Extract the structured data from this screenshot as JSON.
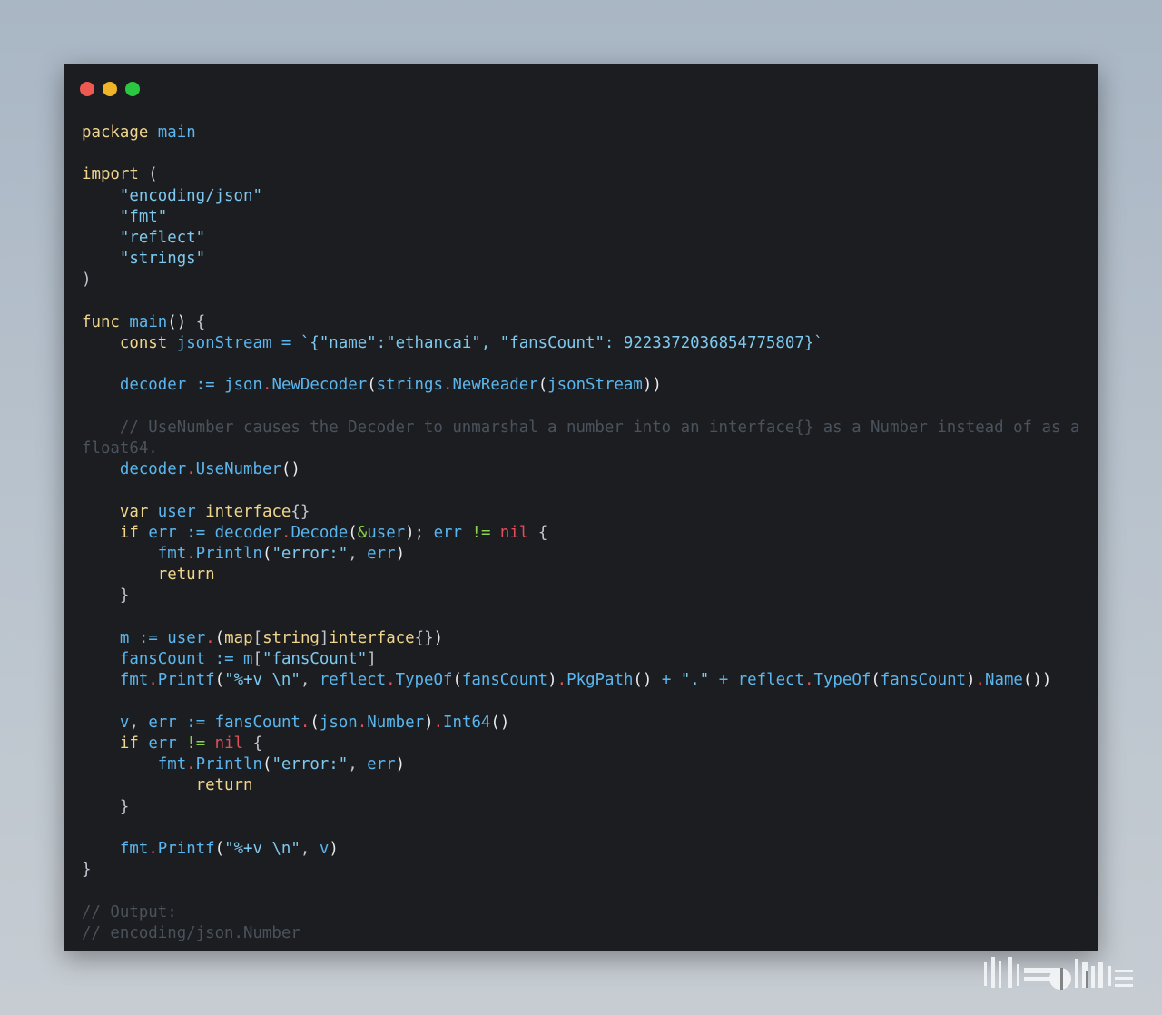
{
  "window": {
    "traffic_lights": [
      {
        "name": "close",
        "color": "#ee5a52"
      },
      {
        "name": "minimize",
        "color": "#f0b428"
      },
      {
        "name": "maximize",
        "color": "#2ac840"
      }
    ]
  },
  "code": {
    "language": "go",
    "lines": [
      [
        [
          "kw",
          "package"
        ],
        [
          "plain",
          " "
        ],
        [
          "id",
          "main"
        ]
      ],
      [],
      [
        [
          "kw",
          "import"
        ],
        [
          "plain",
          " ("
        ]
      ],
      [
        [
          "plain",
          "    "
        ],
        [
          "str",
          "\"encoding/json\""
        ]
      ],
      [
        [
          "plain",
          "    "
        ],
        [
          "str",
          "\"fmt\""
        ]
      ],
      [
        [
          "plain",
          "    "
        ],
        [
          "str",
          "\"reflect\""
        ]
      ],
      [
        [
          "plain",
          "    "
        ],
        [
          "str",
          "\"strings\""
        ]
      ],
      [
        [
          "plain",
          ")"
        ]
      ],
      [],
      [
        [
          "kw",
          "func"
        ],
        [
          "plain",
          " "
        ],
        [
          "id",
          "main"
        ],
        [
          "paren",
          "()"
        ],
        [
          "plain",
          " {"
        ]
      ],
      [
        [
          "plain",
          "    "
        ],
        [
          "kw",
          "const"
        ],
        [
          "plain",
          " "
        ],
        [
          "id",
          "jsonStream"
        ],
        [
          "plain",
          " "
        ],
        [
          "op",
          "="
        ],
        [
          "plain",
          " "
        ],
        [
          "str",
          "`{\"name\":\"ethancai\", \"fansCount\": 9223372036854775807}`"
        ]
      ],
      [],
      [
        [
          "plain",
          "    "
        ],
        [
          "id",
          "decoder"
        ],
        [
          "plain",
          " "
        ],
        [
          "op",
          ":="
        ],
        [
          "plain",
          " "
        ],
        [
          "id",
          "json"
        ],
        [
          "dotop",
          "."
        ],
        [
          "id",
          "NewDecoder"
        ],
        [
          "paren",
          "("
        ],
        [
          "id",
          "strings"
        ],
        [
          "dotop",
          "."
        ],
        [
          "id",
          "NewReader"
        ],
        [
          "paren",
          "("
        ],
        [
          "id",
          "jsonStream"
        ],
        [
          "paren",
          "))"
        ]
      ],
      [],
      [
        [
          "plain",
          "    "
        ],
        [
          "cmt",
          "// UseNumber causes the Decoder to unmarshal a number into an interface{} as a Number instead of as a float64."
        ]
      ],
      [
        [
          "plain",
          "    "
        ],
        [
          "id",
          "decoder"
        ],
        [
          "dotop",
          "."
        ],
        [
          "id",
          "UseNumber"
        ],
        [
          "paren",
          "()"
        ]
      ],
      [],
      [
        [
          "plain",
          "    "
        ],
        [
          "kw",
          "var"
        ],
        [
          "plain",
          " "
        ],
        [
          "id",
          "user"
        ],
        [
          "plain",
          " "
        ],
        [
          "kw",
          "interface"
        ],
        [
          "plain",
          "{}"
        ]
      ],
      [
        [
          "plain",
          "    "
        ],
        [
          "kw",
          "if"
        ],
        [
          "plain",
          " "
        ],
        [
          "id",
          "err"
        ],
        [
          "plain",
          " "
        ],
        [
          "op",
          ":="
        ],
        [
          "plain",
          " "
        ],
        [
          "id",
          "decoder"
        ],
        [
          "dotop",
          "."
        ],
        [
          "id",
          "Decode"
        ],
        [
          "paren",
          "("
        ],
        [
          "amp",
          "&"
        ],
        [
          "id",
          "user"
        ],
        [
          "paren",
          ")"
        ],
        [
          "plain",
          "; "
        ],
        [
          "id",
          "err"
        ],
        [
          "plain",
          " "
        ],
        [
          "neq",
          "!="
        ],
        [
          "plain",
          " "
        ],
        [
          "nil",
          "nil"
        ],
        [
          "plain",
          " {"
        ]
      ],
      [
        [
          "plain",
          "        "
        ],
        [
          "id",
          "fmt"
        ],
        [
          "dotop",
          "."
        ],
        [
          "id",
          "Println"
        ],
        [
          "paren",
          "("
        ],
        [
          "str",
          "\"error:\""
        ],
        [
          "plain",
          ", "
        ],
        [
          "id",
          "err"
        ],
        [
          "paren",
          ")"
        ]
      ],
      [
        [
          "plain",
          "        "
        ],
        [
          "kw",
          "return"
        ]
      ],
      [
        [
          "plain",
          "    }"
        ]
      ],
      [],
      [
        [
          "plain",
          "    "
        ],
        [
          "id",
          "m"
        ],
        [
          "plain",
          " "
        ],
        [
          "op",
          ":="
        ],
        [
          "plain",
          " "
        ],
        [
          "id",
          "user"
        ],
        [
          "dotop",
          "."
        ],
        [
          "paren",
          "("
        ],
        [
          "kw",
          "map"
        ],
        [
          "plain",
          "["
        ],
        [
          "kw",
          "string"
        ],
        [
          "plain",
          "]"
        ],
        [
          "kw",
          "interface"
        ],
        [
          "plain",
          "{}"
        ],
        [
          "paren",
          ")"
        ]
      ],
      [
        [
          "plain",
          "    "
        ],
        [
          "id",
          "fansCount"
        ],
        [
          "plain",
          " "
        ],
        [
          "op",
          ":="
        ],
        [
          "plain",
          " "
        ],
        [
          "id",
          "m"
        ],
        [
          "plain",
          "["
        ],
        [
          "str",
          "\"fansCount\""
        ],
        [
          "plain",
          "]"
        ]
      ],
      [
        [
          "plain",
          "    "
        ],
        [
          "id",
          "fmt"
        ],
        [
          "dotop",
          "."
        ],
        [
          "id",
          "Printf"
        ],
        [
          "paren",
          "("
        ],
        [
          "str",
          "\"%+v \\n\""
        ],
        [
          "plain",
          ", "
        ],
        [
          "id",
          "reflect"
        ],
        [
          "dotop",
          "."
        ],
        [
          "id",
          "TypeOf"
        ],
        [
          "paren",
          "("
        ],
        [
          "id",
          "fansCount"
        ],
        [
          "paren",
          ")"
        ],
        [
          "dotop",
          "."
        ],
        [
          "id",
          "PkgPath"
        ],
        [
          "paren",
          "()"
        ],
        [
          "plain",
          " "
        ],
        [
          "op",
          "+"
        ],
        [
          "plain",
          " "
        ],
        [
          "str",
          "\".\""
        ],
        [
          "plain",
          " "
        ],
        [
          "op",
          "+"
        ],
        [
          "plain",
          " "
        ],
        [
          "id",
          "reflect"
        ],
        [
          "dotop",
          "."
        ],
        [
          "id",
          "TypeOf"
        ],
        [
          "paren",
          "("
        ],
        [
          "id",
          "fansCount"
        ],
        [
          "paren",
          ")"
        ],
        [
          "dotop",
          "."
        ],
        [
          "id",
          "Name"
        ],
        [
          "paren",
          "())"
        ]
      ],
      [],
      [
        [
          "plain",
          "    "
        ],
        [
          "id",
          "v"
        ],
        [
          "plain",
          ", "
        ],
        [
          "id",
          "err"
        ],
        [
          "plain",
          " "
        ],
        [
          "op",
          ":="
        ],
        [
          "plain",
          " "
        ],
        [
          "id",
          "fansCount"
        ],
        [
          "dotop",
          "."
        ],
        [
          "paren",
          "("
        ],
        [
          "id",
          "json"
        ],
        [
          "dotop",
          "."
        ],
        [
          "id",
          "Number"
        ],
        [
          "paren",
          ")"
        ],
        [
          "dotop",
          "."
        ],
        [
          "id",
          "Int64"
        ],
        [
          "paren",
          "()"
        ]
      ],
      [
        [
          "plain",
          "    "
        ],
        [
          "kw",
          "if"
        ],
        [
          "plain",
          " "
        ],
        [
          "id",
          "err"
        ],
        [
          "plain",
          " "
        ],
        [
          "neq",
          "!="
        ],
        [
          "plain",
          " "
        ],
        [
          "nil",
          "nil"
        ],
        [
          "plain",
          " {"
        ]
      ],
      [
        [
          "plain",
          "        "
        ],
        [
          "id",
          "fmt"
        ],
        [
          "dotop",
          "."
        ],
        [
          "id",
          "Println"
        ],
        [
          "paren",
          "("
        ],
        [
          "str",
          "\"error:\""
        ],
        [
          "plain",
          ", "
        ],
        [
          "id",
          "err"
        ],
        [
          "paren",
          ")"
        ]
      ],
      [
        [
          "plain",
          "            "
        ],
        [
          "kw",
          "return"
        ]
      ],
      [
        [
          "plain",
          "    }"
        ]
      ],
      [],
      [
        [
          "plain",
          "    "
        ],
        [
          "id",
          "fmt"
        ],
        [
          "dotop",
          "."
        ],
        [
          "id",
          "Printf"
        ],
        [
          "paren",
          "("
        ],
        [
          "str",
          "\"%+v \\n\""
        ],
        [
          "plain",
          ", "
        ],
        [
          "id",
          "v"
        ],
        [
          "paren",
          ")"
        ]
      ],
      [
        [
          "plain",
          "}"
        ]
      ],
      [],
      [
        [
          "cmt",
          "// Output:"
        ]
      ],
      [
        [
          "cmt",
          "// encoding/json.Number"
        ]
      ]
    ]
  },
  "watermark": {
    "icon": "watermark-logo-icon"
  }
}
